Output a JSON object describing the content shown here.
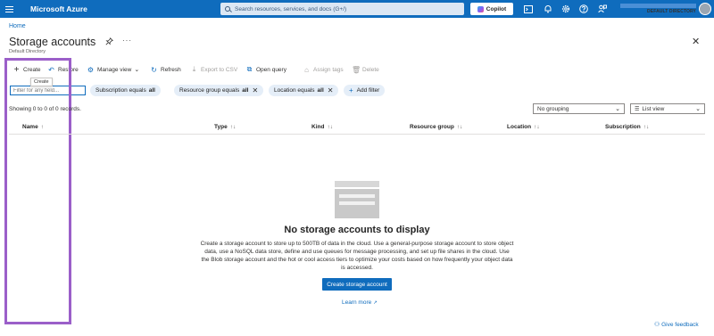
{
  "topbar": {
    "brand": "Microsoft Azure",
    "search_placeholder": "Search resources, services, and docs (G+/)",
    "copilot_label": "Copilot",
    "directory_label": "DEFAULT DIRECTORY"
  },
  "breadcrumb": {
    "home": "Home"
  },
  "page": {
    "title": "Storage accounts",
    "subtitle": "Default Directory"
  },
  "commands": {
    "create": "Create",
    "restore": "Restore",
    "manage_view": "Manage view",
    "refresh": "Refresh",
    "export_csv": "Export to CSV",
    "open_query": "Open query",
    "assign_tags": "Assign tags",
    "delete": "Delete"
  },
  "tooltip": {
    "text": "Create"
  },
  "filters": {
    "input_placeholder": "Filter for any field...",
    "pills": [
      {
        "name": "Subscription equals",
        "value": "all"
      },
      {
        "name": "Resource group equals",
        "value": "all"
      },
      {
        "name": "Location equals",
        "value": "all"
      }
    ],
    "add_filter": "Add filter"
  },
  "records": {
    "text": "Showing 0 to 0 of 0 records."
  },
  "grouping": {
    "selected": "No grouping"
  },
  "view": {
    "selected": "List view"
  },
  "table": {
    "columns": [
      "Name",
      "Type",
      "Kind",
      "Resource group",
      "Location",
      "Subscription"
    ]
  },
  "empty_state": {
    "title": "No storage accounts to display",
    "description": "Create a storage account to store up to 500TB of data in the cloud. Use a general-purpose storage account to store object data, use a NoSQL data store, define and use queues for message processing, and set up file shares in the cloud. Use the Blob storage account and the hot or cool access tiers to optimize your costs based on how frequently your object data is accessed.",
    "button": "Create storage account",
    "learn_more": "Learn more"
  },
  "feedback": {
    "label": "Give feedback"
  },
  "colors": {
    "topbar": "#0f6cbd",
    "accent": "#0f6cbd",
    "highlight": "#9b5fc9",
    "pill_bg": "#e5eef8"
  }
}
